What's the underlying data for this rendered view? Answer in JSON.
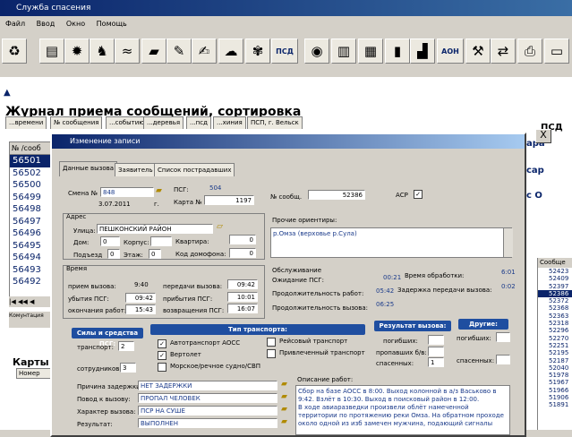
{
  "app": {
    "title": "Служба спасения",
    "menu": [
      "Файл",
      "Ввод",
      "Окно",
      "Помощь"
    ],
    "toolbar_text_buttons": {
      "psd": "ПСД",
      "aon": "АОН"
    }
  },
  "journal": {
    "title": "Журнал приема сообщений, сортировка",
    "tabs": [
      "...времени",
      "№ сообщения",
      "...событию",
      "...деревья",
      "...псд",
      "...хиния",
      "ПСП, г. Вельск"
    ],
    "list_header": "№ /сооб",
    "list_items": [
      "56501",
      "56502",
      "56500",
      "56499",
      "56498",
      "56497",
      "56496",
      "56495",
      "56494",
      "56493",
      "56492"
    ],
    "selected_index": 0,
    "komm_label": "Комунтация",
    "karty_label": "Карты в",
    "nomer_label": "Номер"
  },
  "right_panel": {
    "psd_header": "ПСД",
    "fragments": [
      "ара",
      "сар",
      "с О"
    ],
    "list_header": "Сообще",
    "list_items": [
      "52423",
      "52409",
      "52397",
      "52386",
      "52372",
      "52368",
      "52363",
      "52318",
      "52296",
      "52270",
      "52251",
      "52195",
      "52187",
      "52040",
      "51978",
      "51967",
      "51966",
      "51906",
      "51891"
    ],
    "selected_index": 3
  },
  "dialog": {
    "title": "Изменение записи",
    "close": "X",
    "tabs": [
      "Данные вызова",
      "Заявитель",
      "Список пострадавших"
    ],
    "active_tab": 0,
    "smena_label": "Смена №",
    "smena_value": "848",
    "date_value": "3.07.2011",
    "date_suffix": "г.",
    "psg_label": "ПСГ:",
    "psg_value": "504",
    "karta_label": "Карта №",
    "karta_value": "1197",
    "nsoob_label": "№ сообщ.",
    "nsoob_value": "52386",
    "asr_label": "АСР",
    "asr_checked": "✓",
    "address": {
      "label": "Адрес",
      "street_label": "Улица:",
      "street_value": "ПЕШКОНСКИЙ РАЙОН",
      "dom_label": "Дом:",
      "dom_value": "0",
      "korpus_label": "Корпус:",
      "korpus_value": "",
      "kvartira_label": "Квартира:",
      "kvartira_value": "0",
      "podezd_label": "Подъезд",
      "podezd_value": "0",
      "etazh_label": "Этаж:",
      "etazh_value": "0",
      "kod_label": "Код домофона:",
      "kod_value": "0"
    },
    "prochie": {
      "label": "Прочие ориентиры:",
      "value": "р.Омза (верховье р.Сула)"
    },
    "vremya": {
      "label": "Время",
      "priem_label": "прием вызова:",
      "priem_value": "9:40",
      "peredachi_label": "передачи вызова:",
      "peredachi_value": "09:42",
      "ubytie_label": "убытия ПСГ:",
      "ubytie_value": "09:42",
      "pribytie_label": "прибытия ПСГ:",
      "pribytie_value": "10:01",
      "okonchanie_label": "окончания работ:",
      "okonchanie_value": "15:43",
      "vozvr_label": "возвращения ПСГ:",
      "vozvr_value": "16:07"
    },
    "obsluzh": {
      "label": "Обслуживание",
      "ozhid_label": "Ожидание ПСГ:",
      "ozhid_value": "00:21",
      "obrab_label": "Время обработки:",
      "obrab_value": "6:01",
      "prodrab_label": "Продолжительность работ:",
      "prodrab_value": "05:42",
      "zaderzh_label": "Задержка передачи вызова:",
      "zaderzh_value": "0:02",
      "prodvyz_label": "Продолжительность вызова:",
      "prodvyz_value": "06:25"
    },
    "sily": {
      "header": "Силы и средства ПСГ:",
      "transport_label": "транспорт:",
      "transport_value": "2",
      "sotrud_label": "сотрудников:",
      "sotrud_value": "3"
    },
    "tip": {
      "header": "Тип транспорта:",
      "items": [
        "Автотранспорт АОСС",
        "Вертолет",
        "Морское/речное судно/СВП",
        "Рейсовый транспорт",
        "Привлеченный транспорт"
      ],
      "checked": [
        "✓",
        "✓",
        "",
        "",
        ""
      ]
    },
    "rezult": {
      "header": "Результат вызова:",
      "pogibshih_label": "погибших:",
      "propavshih_label": "пропавших б/в:",
      "spasennyh_label": "спасенных:",
      "spasennyh_value": "1"
    },
    "drugie": {
      "header": "Другие:",
      "pogibshih_label": "погибших:",
      "spasennyh_label": "спасенных:"
    },
    "bottom": {
      "zaderzhki_label": "Причина задержки:",
      "zaderzhki_value": "НЕТ ЗАДЕРЖКИ",
      "povod_label": "Повод к вызову:",
      "povod_value": "ПРОПАЛ ЧЕЛОВЕК",
      "harakter_label": "Характер вызова:",
      "harakter_value": "ПСР НА СУШЕ",
      "rezultat_label": "Результат:",
      "rezultat_value": "ВЫПОЛНЕН"
    },
    "opisanie": {
      "label": "Описание работ:",
      "lines": [
        "Сбор на базе АОСС в 8:00. Выход колонной в а/з Васьково в",
        "9:42. Взлёт в 10:30. Выход в поисковый район в 12:00.",
        "В ходе авиаразведки произвели облёт намеченной",
        "территории по протяжению реки Омза. На обратном проходе",
        "около одной из изб замечен мужчина, подающий сигналы"
      ]
    }
  }
}
